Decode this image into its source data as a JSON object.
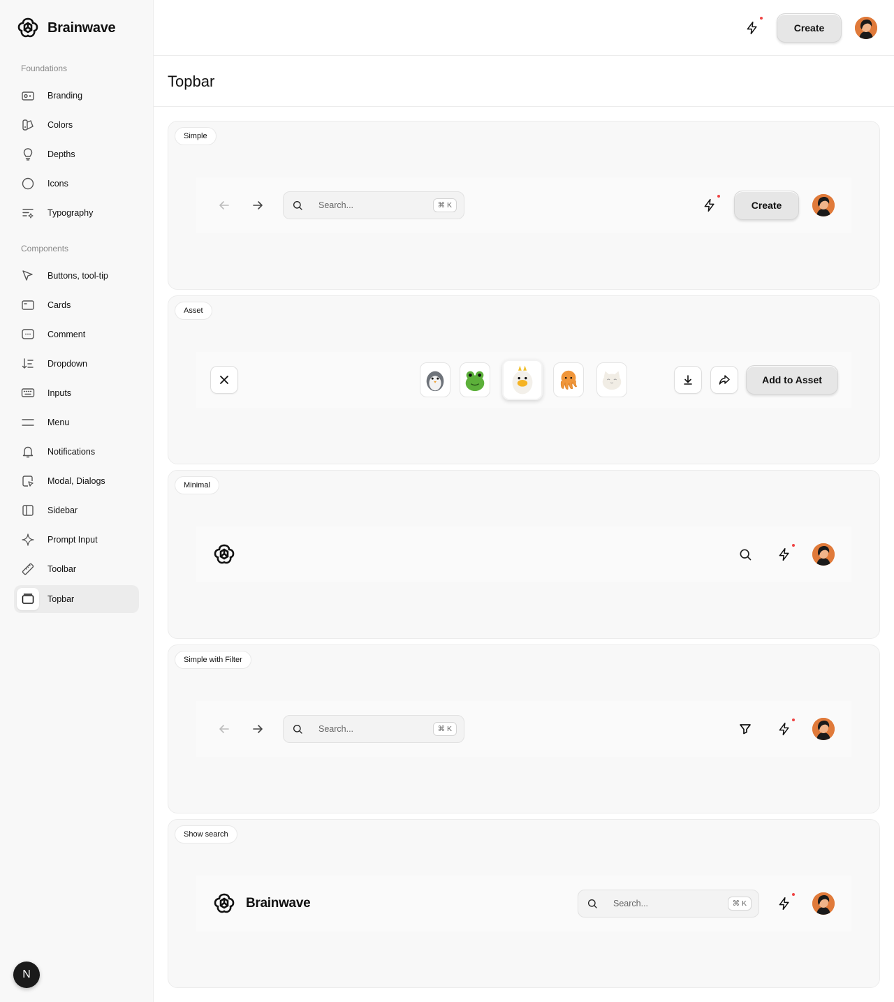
{
  "brand": {
    "name": "Brainwave"
  },
  "sidebar": {
    "foundations_title": "Foundations",
    "foundations": [
      {
        "label": "Branding",
        "icon": "branding-icon"
      },
      {
        "label": "Colors",
        "icon": "colors-icon"
      },
      {
        "label": "Depths",
        "icon": "depths-icon"
      },
      {
        "label": "Icons",
        "icon": "icons-icon"
      },
      {
        "label": "Typography",
        "icon": "typography-icon"
      }
    ],
    "components_title": "Components",
    "components": [
      {
        "label": "Buttons, tool-tip",
        "icon": "cursor-icon"
      },
      {
        "label": "Cards",
        "icon": "card-icon"
      },
      {
        "label": "Comment",
        "icon": "comment-icon"
      },
      {
        "label": "Dropdown",
        "icon": "sort-icon"
      },
      {
        "label": "Inputs",
        "icon": "keyboard-icon"
      },
      {
        "label": "Menu",
        "icon": "menu-icon"
      },
      {
        "label": "Notifications",
        "icon": "bell-icon"
      },
      {
        "label": "Modal, Dialogs",
        "icon": "modal-icon"
      },
      {
        "label": "Sidebar",
        "icon": "sidebar-icon"
      },
      {
        "label": "Prompt Input",
        "icon": "sparkle-icon"
      },
      {
        "label": "Toolbar",
        "icon": "ruler-icon"
      },
      {
        "label": "Topbar",
        "icon": "topbar-icon",
        "active": true
      }
    ],
    "bottom_badge": "N"
  },
  "header": {
    "create_label": "Create"
  },
  "page": {
    "title": "Topbar"
  },
  "demos": {
    "simple": {
      "label": "Simple",
      "search_placeholder": "Search...",
      "shortcut": "⌘ K",
      "create_label": "Create"
    },
    "asset": {
      "label": "Asset",
      "add_label": "Add to Asset",
      "assets": [
        "penguin",
        "frog",
        "chick",
        "octopus",
        "cat"
      ],
      "selected_index": 2
    },
    "minimal": {
      "label": "Minimal"
    },
    "filter": {
      "label": "Simple with Filter",
      "search_placeholder": "Search...",
      "shortcut": "⌘ K"
    },
    "show_search": {
      "label": "Show search",
      "brand": "Brainwave",
      "search_placeholder": "Search...",
      "shortcut": "⌘ K"
    }
  },
  "colors": {
    "accent_dot": "#ef4444",
    "avatar": "#e07a3a"
  }
}
